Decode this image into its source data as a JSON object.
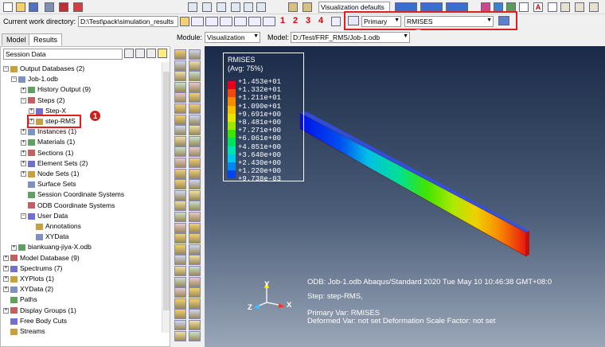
{
  "toolbar": {
    "view_set": "Visualization defaults",
    "numbers": [
      "1",
      "2",
      "3",
      "4"
    ]
  },
  "cwd": {
    "label": "Current work directory:",
    "value": "D:\\Test\\pack\\simulation_results"
  },
  "field_output": {
    "step_option": "Primary",
    "variable": "RMISES"
  },
  "module": {
    "label": "Module:",
    "value": "Visualization",
    "model_label": "Model:",
    "model_value": "D:/Test/FRF_RMS/Job-1.odb"
  },
  "tabs": {
    "model": "Model",
    "results": "Results"
  },
  "session_combo": "Session Data",
  "badges": {
    "one": "1",
    "two": "2"
  },
  "tree": [
    {
      "label": "Output Databases (2)",
      "x": 4,
      "exp": "−"
    },
    {
      "label": "Job-1.odb",
      "x": 14,
      "exp": "−"
    },
    {
      "label": "History Output (9)",
      "x": 26,
      "exp": "+"
    },
    {
      "label": "Steps (2)",
      "x": 26,
      "exp": "−"
    },
    {
      "label": "Step-X",
      "x": 36,
      "exp": "+"
    },
    {
      "label": "step-RMS",
      "x": 36,
      "exp": "+"
    },
    {
      "label": "Instances (1)",
      "x": 26,
      "exp": "+"
    },
    {
      "label": "Materials (1)",
      "x": 26,
      "exp": "+"
    },
    {
      "label": "Sections (1)",
      "x": 26,
      "exp": "+"
    },
    {
      "label": "Element Sets (2)",
      "x": 26,
      "exp": "+"
    },
    {
      "label": "Node Sets (1)",
      "x": 26,
      "exp": "+"
    },
    {
      "label": "Surface Sets",
      "x": 26,
      "exp": ""
    },
    {
      "label": "Session Coordinate Systems",
      "x": 26,
      "exp": ""
    },
    {
      "label": "ODB Coordinate Systems",
      "x": 26,
      "exp": ""
    },
    {
      "label": "User Data",
      "x": 26,
      "exp": "−"
    },
    {
      "label": "Annotations",
      "x": 36,
      "exp": ""
    },
    {
      "label": "XYData",
      "x": 36,
      "exp": ""
    },
    {
      "label": "biankuang-jiya-X.odb",
      "x": 14,
      "exp": "+"
    },
    {
      "label": "Model Database (9)",
      "x": 4,
      "exp": "+"
    },
    {
      "label": "Spectrums (7)",
      "x": 4,
      "exp": "+"
    },
    {
      "label": "XYPlots (1)",
      "x": 4,
      "exp": "+"
    },
    {
      "label": "XYData (2)",
      "x": 4,
      "exp": "+"
    },
    {
      "label": "Paths",
      "x": 4,
      "exp": ""
    },
    {
      "label": "Display Groups (1)",
      "x": 4,
      "exp": "+"
    },
    {
      "label": "Free Body Cuts",
      "x": 4,
      "exp": ""
    },
    {
      "label": "Streams",
      "x": 4,
      "exp": ""
    }
  ],
  "legend": {
    "title": "RMISES",
    "subtitle": "(Avg: 75%)",
    "values": [
      "+1.453e+01",
      "+1.332e+01",
      "+1.211e+01",
      "+1.090e+01",
      "+9.691e+00",
      "+8.481e+00",
      "+7.271e+00",
      "+6.061e+00",
      "+4.851e+00",
      "+3.640e+00",
      "+2.430e+00",
      "+1.220e+00",
      "+9.738e-03"
    ],
    "colors": [
      "#e8001a",
      "#f04810",
      "#f88a00",
      "#f6c200",
      "#e6e600",
      "#9be800",
      "#3ce400",
      "#00e25a",
      "#00e2b0",
      "#00c8ec",
      "#0088f0",
      "#0044f0",
      "#0000e8"
    ]
  },
  "axes": {
    "y": "Y",
    "x": "X",
    "z": "Z"
  },
  "info": {
    "line1": "ODB: Job-1.odb    Abaqus/Standard 2020    Tue May 10 10:46:38 GMT+08:0",
    "line2": "Step: step-RMS,",
    "line3": "Primary Var: RMISES",
    "line4": "Deformed Var: not set   Deformation Scale Factor: not set"
  }
}
